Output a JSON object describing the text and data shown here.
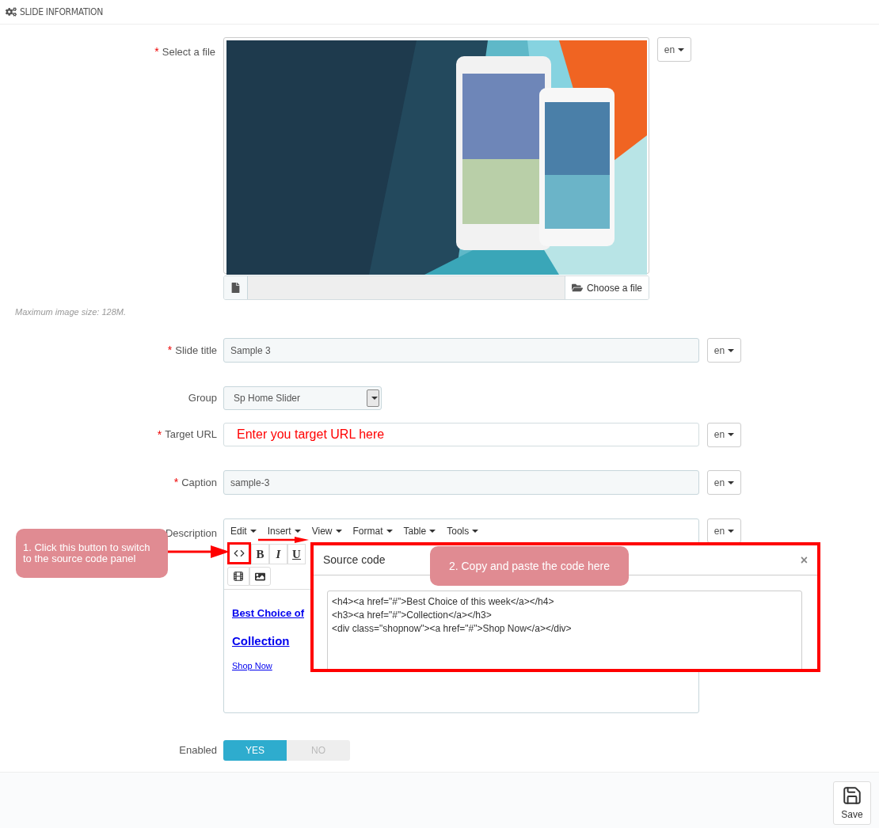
{
  "panel": {
    "title": "SLIDE INFORMATION"
  },
  "file": {
    "label": "Select a file",
    "required_mark": "*",
    "lang": "en",
    "button": "Choose a file",
    "note": "Maximum image size: 128M."
  },
  "slide_title": {
    "label": "Slide title",
    "required_mark": "*",
    "value": "Sample 3",
    "lang": "en"
  },
  "group": {
    "label": "Group",
    "value": "Sp Home Slider"
  },
  "target_url": {
    "label": "Target URL",
    "required_mark": "*",
    "value": "Enter you target URL here",
    "lang": "en"
  },
  "caption": {
    "label": "Caption",
    "required_mark": "*",
    "value": "sample-3",
    "lang": "en"
  },
  "description": {
    "label": "Description",
    "lang": "en",
    "menu": [
      "Edit",
      "Insert",
      "View",
      "Format",
      "Table",
      "Tools"
    ],
    "format_buttons": [
      {
        "kind": "bold",
        "label": "B"
      },
      {
        "kind": "italic",
        "label": "I"
      },
      {
        "kind": "underline",
        "label": "U"
      }
    ],
    "content": [
      {
        "kind": "h4",
        "text": "Best Choice of"
      },
      {
        "kind": "h3",
        "text": "Collection"
      },
      {
        "kind": "div",
        "text": "Shop Now"
      }
    ]
  },
  "source_dialog": {
    "title": "Source code",
    "close": "×",
    "code": [
      "<h4><a href=\"#\">Best Choice of this week</a></h4>",
      "<h3><a href=\"#\">Collection</a></h3>",
      "<div class=\"shopnow\"><a href=\"#\">Shop Now</a></div>"
    ]
  },
  "enabled": {
    "label": "Enabled",
    "options": [
      {
        "label": "YES",
        "selected": true
      },
      {
        "label": "NO",
        "selected": false
      }
    ]
  },
  "footer": {
    "save": "Save"
  },
  "annotations": [
    {
      "text": "1. Click this button to switch to the source code panel"
    },
    {
      "text": "2. Copy and paste the code here"
    }
  ]
}
